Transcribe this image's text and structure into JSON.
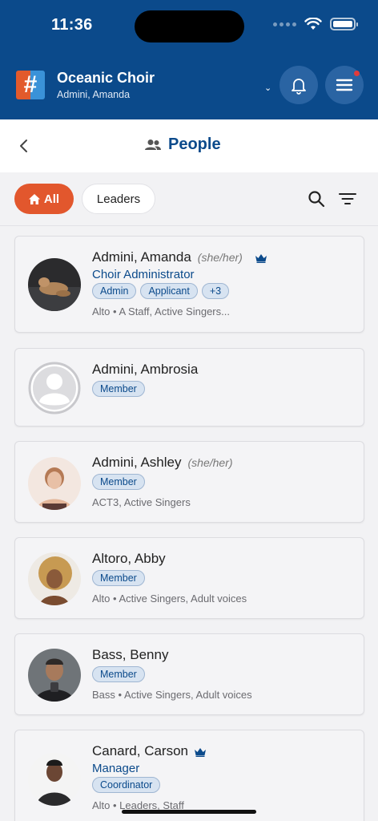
{
  "status_bar": {
    "time": "11:36"
  },
  "header": {
    "org_name": "Oceanic Choir",
    "current_user": "Admini, Amanda",
    "logo_glyph": "#",
    "colors": {
      "background": "#0b4a8b",
      "button": "#2a64a3",
      "logo_left": "#e25a2c",
      "logo_right": "#3a92d8",
      "notification_dot": "#e23b3b"
    }
  },
  "page": {
    "title": "People"
  },
  "filters": {
    "all_label": "All",
    "leaders_label": "Leaders",
    "active_filter": "All",
    "active_color": "#e2572d"
  },
  "people": [
    {
      "name": "Admini, Amanda",
      "pronouns": "(she/her)",
      "leader": true,
      "role": "Choir Administrator",
      "tags": [
        "Admin",
        "Applicant",
        "+3"
      ],
      "groups": "Alto • A Staff, Active Singers..."
    },
    {
      "name": "Admini, Ambrosia",
      "pronouns": "",
      "leader": false,
      "role": "",
      "tags": [
        "Member"
      ],
      "groups": ""
    },
    {
      "name": "Admini, Ashley",
      "pronouns": "(she/her)",
      "leader": false,
      "role": "",
      "tags": [
        "Member"
      ],
      "groups": "ACT3, Active Singers"
    },
    {
      "name": "Altoro, Abby",
      "pronouns": "",
      "leader": false,
      "role": "",
      "tags": [
        "Member"
      ],
      "groups": "Alto • Active Singers, Adult voices"
    },
    {
      "name": "Bass, Benny",
      "pronouns": "",
      "leader": false,
      "role": "",
      "tags": [
        "Member"
      ],
      "groups": "Bass • Active Singers, Adult voices"
    },
    {
      "name": "Canard, Carson",
      "pronouns": "",
      "leader": true,
      "role": "Manager",
      "tags": [
        "Coordinator"
      ],
      "groups": "Alto • Leaders, Staff"
    }
  ]
}
